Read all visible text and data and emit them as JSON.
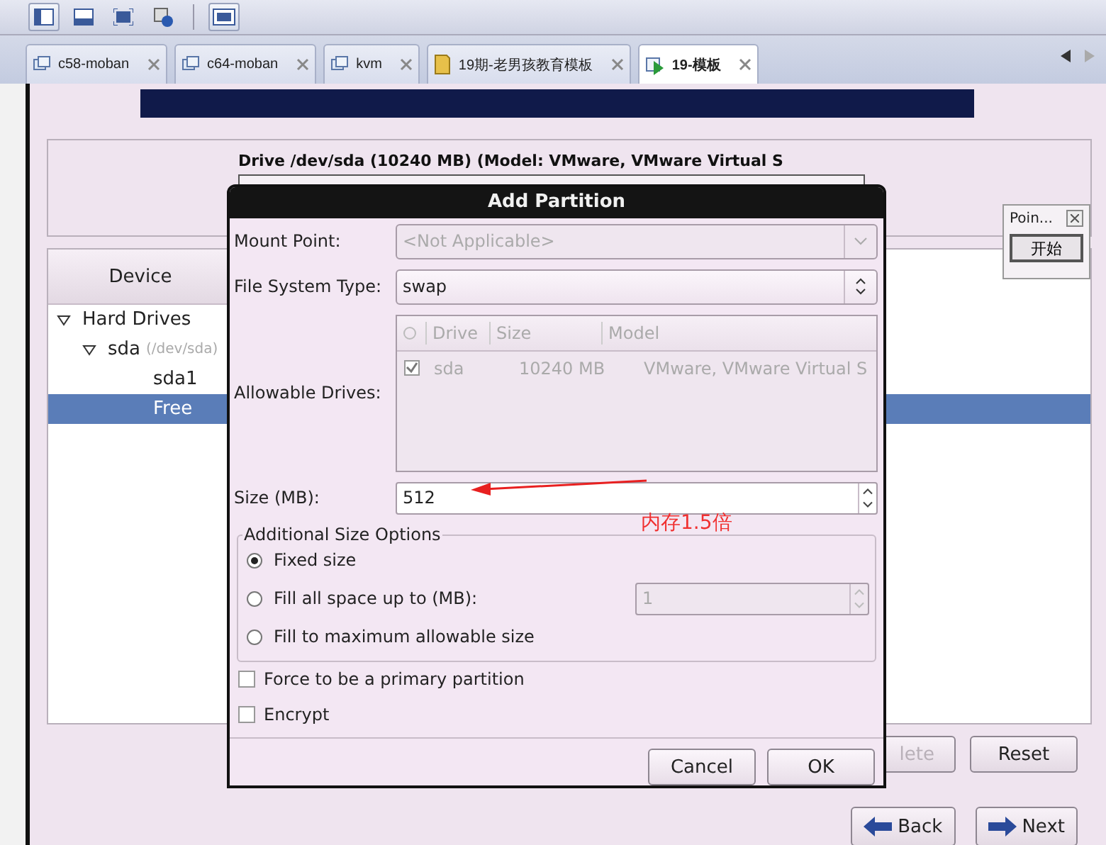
{
  "tabs": [
    {
      "label": "c58-moban",
      "kind": "vm",
      "selected": false
    },
    {
      "label": "c64-moban",
      "kind": "vm",
      "selected": false
    },
    {
      "label": "kvm",
      "kind": "vm",
      "selected": false
    },
    {
      "label": "19期-老男孩教育模板",
      "kind": "folder",
      "selected": false
    },
    {
      "label": "19-模板",
      "kind": "running",
      "selected": true
    }
  ],
  "drive_panel": {
    "label": "Drive /dev/sda (10240 MB) (Model: VMware, VMware Virtual S"
  },
  "device_tree": {
    "header": "Device",
    "items": [
      {
        "label": "Hard Drives",
        "expanded": true,
        "selected": false,
        "children": [
          {
            "label": "sda",
            "sublabel": "(/dev/sda)",
            "expanded": true,
            "selected": false,
            "children": [
              {
                "label": "sda1",
                "selected": false
              },
              {
                "label": "Free",
                "selected": true
              }
            ]
          }
        ]
      }
    ]
  },
  "partition_buttons": [
    {
      "label": "lete",
      "disabled": true
    },
    {
      "label": "Reset",
      "disabled": false
    }
  ],
  "nav_buttons": [
    {
      "label": "Back",
      "kind": "back"
    },
    {
      "label": "Next",
      "kind": "next"
    }
  ],
  "point_window": {
    "title": "Poin...",
    "button": "开始"
  },
  "dialog": {
    "title": "Add Partition",
    "mount_point": {
      "label": "Mount Point:",
      "placeholder": "<Not Applicable>",
      "disabled": true
    },
    "fs_type": {
      "label": "File System Type:",
      "value": "swap"
    },
    "drives": {
      "label": "Allowable Drives:",
      "columns": [
        "Drive",
        "Size",
        "Model"
      ],
      "rows": [
        {
          "checked": true,
          "cells": [
            "sda",
            "10240 MB",
            "VMware, VMware Virtual S"
          ]
        }
      ]
    },
    "size": {
      "label": "Size (MB):",
      "value": "512"
    },
    "size_options": {
      "legend": "Additional Size Options",
      "options": [
        {
          "label": "Fixed size",
          "selected": true
        },
        {
          "label": "Fill all space up to (MB):",
          "selected": false,
          "value": "1"
        },
        {
          "label": "Fill to maximum allowable size",
          "selected": false
        }
      ]
    },
    "checkboxes": [
      {
        "label": "Force to be a primary partition",
        "checked": false
      },
      {
        "label": "Encrypt",
        "checked": false
      }
    ],
    "buttons": [
      "Cancel",
      "OK"
    ]
  },
  "annotation": {
    "text": "内存1.5倍"
  }
}
